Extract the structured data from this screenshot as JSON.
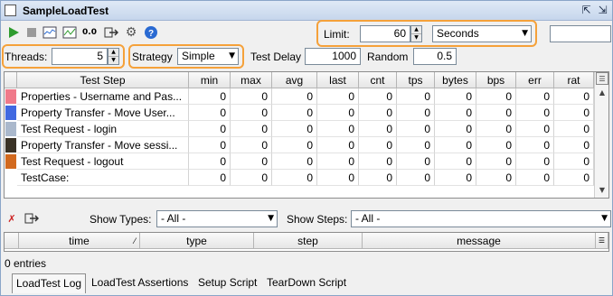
{
  "window": {
    "title": "SampleLoadTest",
    "controls": [
      "detach-icon",
      "close-panel-icon"
    ]
  },
  "toolbar": {
    "icons": [
      "run-icon",
      "stop-icon",
      "chart-icon",
      "statistics-icon",
      "reset-icon",
      "export-icon",
      "options-icon",
      "help-icon"
    ],
    "reset_label": "0.0",
    "limit_label": "Limit:",
    "limit_value": "60",
    "limit_unit": "Seconds",
    "progress_value": ""
  },
  "settings": {
    "threads_label": "Threads:",
    "threads_value": "5",
    "strategy_label": "Strategy",
    "strategy_value": "Simple",
    "delay_label": "Test Delay",
    "delay_value": "1000",
    "random_label": "Random",
    "random_value": "0.5"
  },
  "stats": {
    "columns": [
      "Test Step",
      "min",
      "max",
      "avg",
      "last",
      "cnt",
      "tps",
      "bytes",
      "bps",
      "err",
      "rat"
    ],
    "rows": [
      {
        "color": "#f07a8a",
        "name": "Properties - Username and Pas...",
        "values": [
          "0",
          "0",
          "0",
          "0",
          "0",
          "0",
          "0",
          "0",
          "0",
          "0"
        ]
      },
      {
        "color": "#4169e1",
        "name": "Property Transfer - Move User...",
        "values": [
          "0",
          "0",
          "0",
          "0",
          "0",
          "0",
          "0",
          "0",
          "0",
          "0"
        ]
      },
      {
        "color": "#aab8cc",
        "name": "Test Request - login",
        "values": [
          "0",
          "0",
          "0",
          "0",
          "0",
          "0",
          "0",
          "0",
          "0",
          "0"
        ]
      },
      {
        "color": "#3a3226",
        "name": "Property Transfer - Move sessi...",
        "values": [
          "0",
          "0",
          "0",
          "0",
          "0",
          "0",
          "0",
          "0",
          "0",
          "0"
        ]
      },
      {
        "color": "#d2691e",
        "name": "Test Request - logout",
        "values": [
          "0",
          "0",
          "0",
          "0",
          "0",
          "0",
          "0",
          "0",
          "0",
          "0"
        ]
      },
      {
        "color": "",
        "name": "TestCase:",
        "values": [
          "0",
          "0",
          "0",
          "0",
          "0",
          "0",
          "0",
          "0",
          "0",
          "0"
        ]
      }
    ]
  },
  "log_toolbar": {
    "show_types_label": "Show Types:",
    "show_types_value": "- All -",
    "show_steps_label": "Show Steps:",
    "show_steps_value": "- All -"
  },
  "log": {
    "columns": [
      "time",
      "type",
      "step",
      "message"
    ],
    "entries_label": "0 entries"
  },
  "tabs": [
    "LoadTest Log",
    "LoadTest Assertions",
    "Setup Script",
    "TearDown Script"
  ],
  "accent": {
    "highlight": "#f5a13a",
    "run": "#2e9b2e",
    "help": "#2a6ad2"
  }
}
